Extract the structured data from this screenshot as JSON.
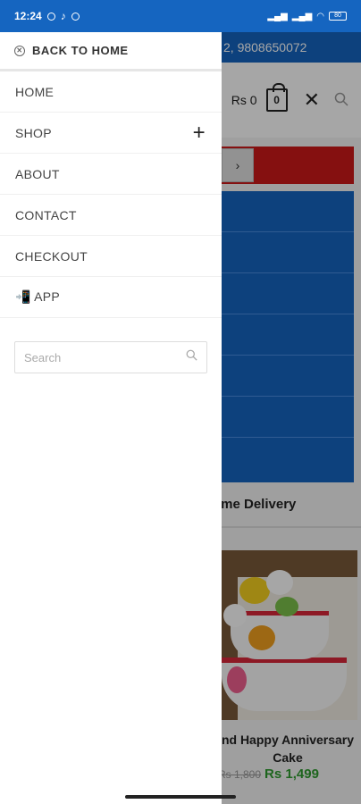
{
  "statusbar": {
    "time": "12:24",
    "battery": "80"
  },
  "background": {
    "topbar_text": "2, 9808650072",
    "cart_label": "Rs 0",
    "cart_count": "0",
    "arrow": "›",
    "section_title": "ome Delivery",
    "product_name": "nd Happy Anniversary Cake",
    "old_price": "Rs 1,800",
    "new_price": "Rs 1,499"
  },
  "drawer": {
    "back_label": "BACK TO HOME",
    "items": [
      {
        "label": "HOME"
      },
      {
        "label": "SHOP",
        "expand": "+"
      },
      {
        "label": "ABOUT"
      },
      {
        "label": "CONTACT"
      },
      {
        "label": "CHECKOUT"
      },
      {
        "label": "📲 APP"
      }
    ],
    "search_placeholder": "Search"
  }
}
